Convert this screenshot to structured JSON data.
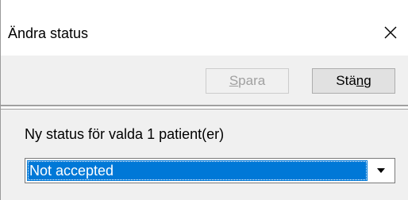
{
  "window": {
    "title": "Ändra status",
    "close_icon": "close-icon"
  },
  "toolbar": {
    "save": {
      "label_underlined": "S",
      "label_rest": "para",
      "enabled": false
    },
    "close": {
      "label_before": "Stä",
      "label_underlined": "n",
      "label_after": "g",
      "enabled": true
    }
  },
  "content": {
    "status_label": "Ny status för valda 1 patient(er)",
    "status_select": {
      "selected": "Not accepted",
      "arrow_icon": "dropdown-arrow-icon"
    }
  },
  "colors": {
    "selection": "#0078d7",
    "panel": "#f0f0f0",
    "disabled_text": "#a0a0a0"
  }
}
